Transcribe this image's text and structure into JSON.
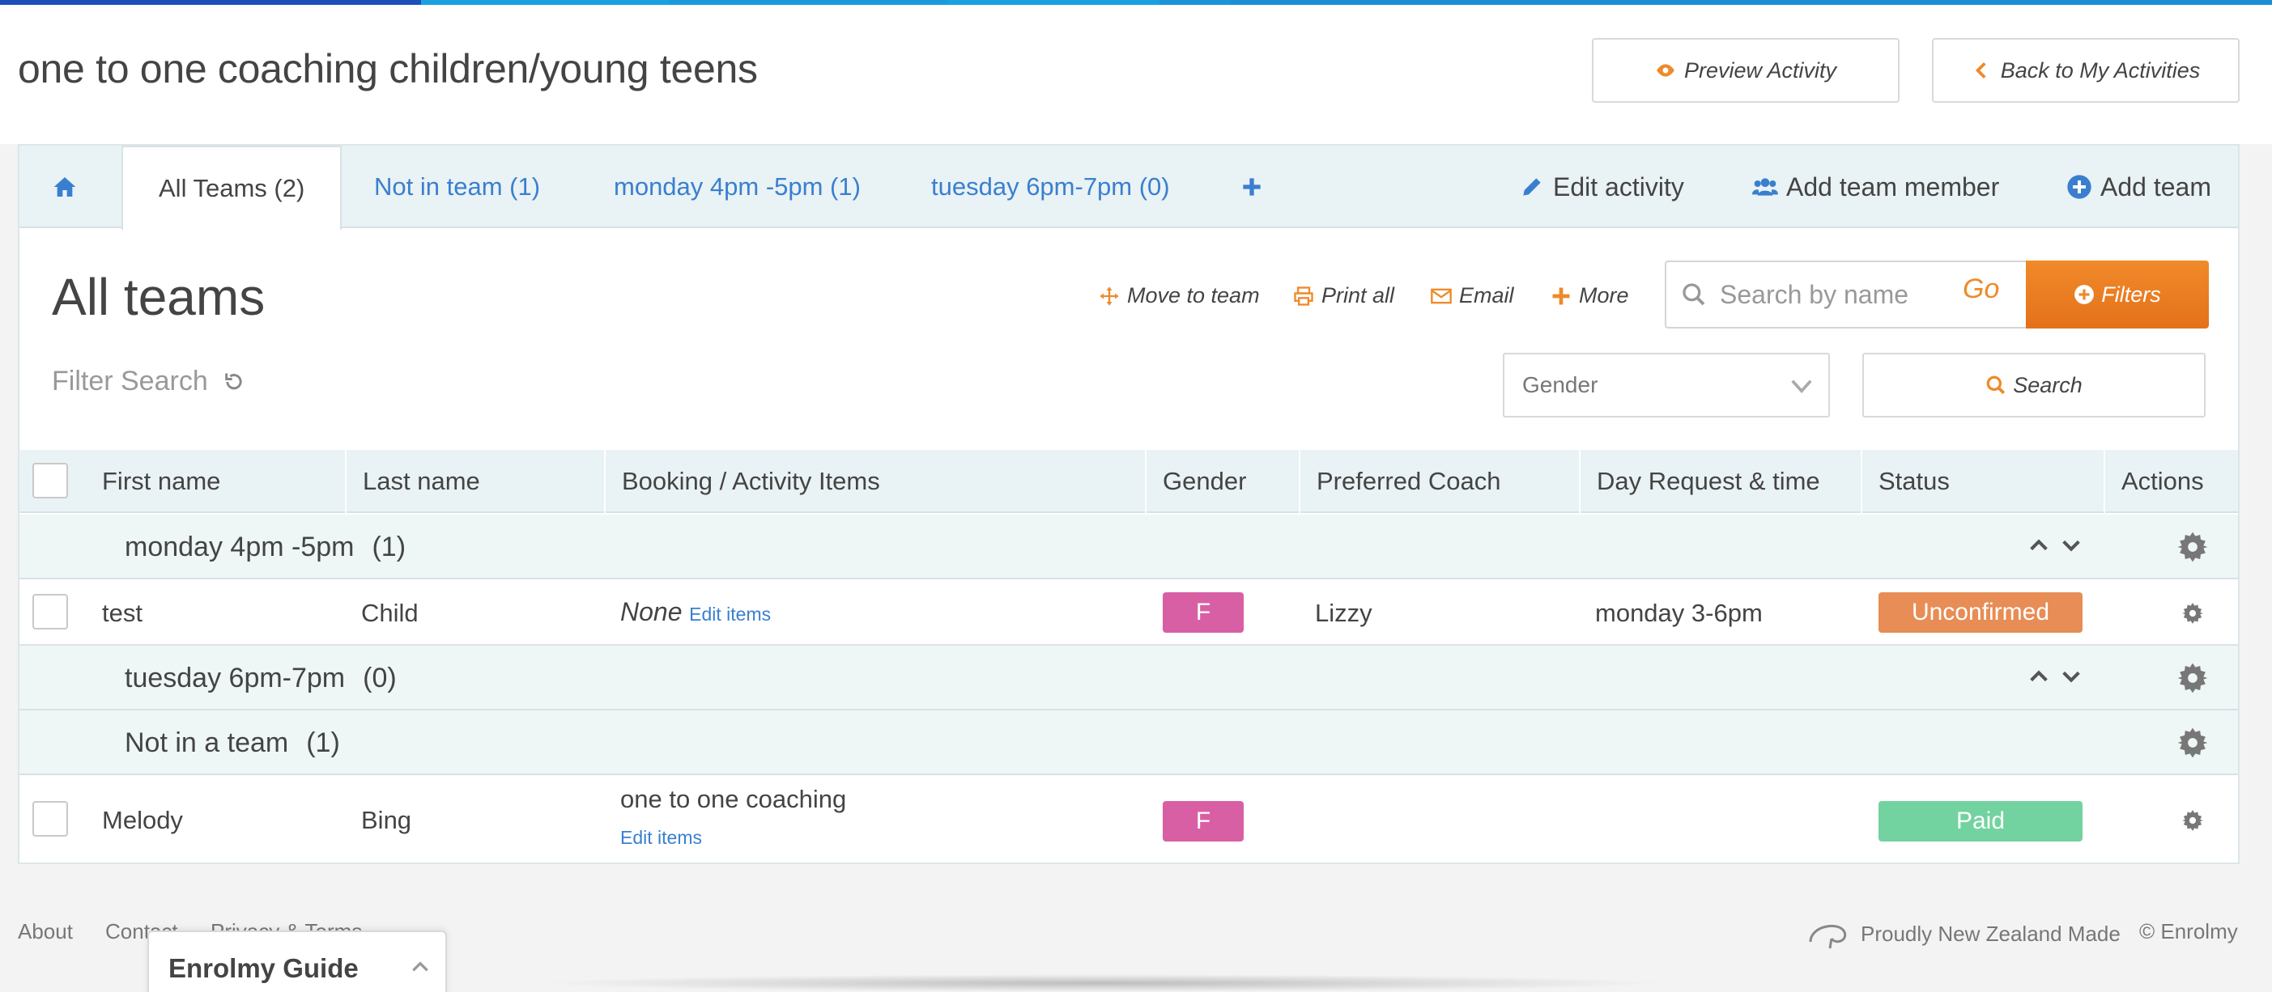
{
  "colors": {
    "topbar": [
      "#1e4fb8",
      "#1aa0e0",
      "#1a8fd6",
      "#1aa0e0",
      "#1a8fd6",
      "#1aa0e0"
    ],
    "accent_orange": "#ee8a2a",
    "link_blue": "#3a7fcf",
    "gender_f": "#d95fa5",
    "unconfirmed": "#e78d55",
    "paid": "#72d3a0"
  },
  "header": {
    "title": "one to one coaching children/young teens",
    "preview_label": "Preview Activity",
    "back_label": "Back to My Activities"
  },
  "tabs": {
    "home_icon": "home-icon",
    "items": [
      {
        "label": "All Teams (2)"
      },
      {
        "label": "Not in team (1)"
      },
      {
        "label": "monday 4pm -5pm (1)"
      },
      {
        "label": "tuesday 6pm-7pm (0)"
      }
    ],
    "add_icon": "plus-icon",
    "edit_activity": "Edit activity",
    "add_team_member": "Add team member",
    "add_team": "Add team"
  },
  "toolbar": {
    "heading": "All teams",
    "move_to_team": "Move to team",
    "print_all": "Print all",
    "email": "Email",
    "more": "More",
    "search_placeholder": "Search by name",
    "go": "Go",
    "filters": "Filters",
    "filter_search": "Filter Search",
    "gender_placeholder": "Gender",
    "search_button": "Search"
  },
  "table": {
    "columns": [
      "First name",
      "Last name",
      "Booking / Activity Items",
      "Gender",
      "Preferred Coach",
      "Day Request & time",
      "Status",
      "Actions"
    ],
    "groups": [
      {
        "name": "monday 4pm -5pm",
        "count": "(1)",
        "rows": [
          {
            "first": "test",
            "last": "Child",
            "booking": "None",
            "edit": "Edit items",
            "gender": "F",
            "coach": "Lizzy",
            "day": "monday 3-6pm",
            "status": "Unconfirmed"
          }
        ]
      },
      {
        "name": "tuesday 6pm-7pm",
        "count": "(0)",
        "rows": []
      },
      {
        "name": "Not in a team",
        "count": "(1)",
        "rows": [
          {
            "first": "Melody",
            "last": "Bing",
            "booking": "one to one coaching",
            "edit": "Edit items",
            "gender": "F",
            "coach": "",
            "day": "",
            "status": "Paid"
          }
        ]
      }
    ]
  },
  "footer": {
    "about": "About",
    "contact": "Contact",
    "privacy": "Privacy & Terms",
    "nz_made": "Proudly New Zealand Made",
    "copyright": "© Enrolmy"
  },
  "guide": {
    "title": "Enrolmy Guide"
  }
}
